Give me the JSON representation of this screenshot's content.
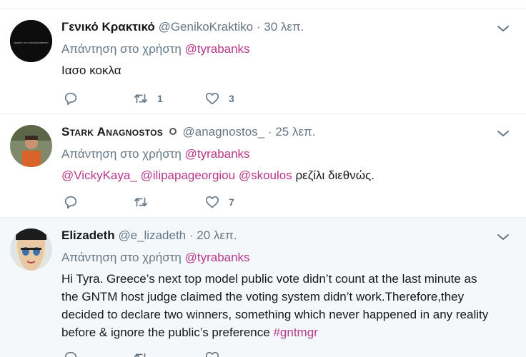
{
  "tweets": [
    {
      "fullname": "Γενικό Κρακτικό",
      "username": "@GenikoKraktiko",
      "separator": "·",
      "time": "30 λεπ.",
      "reply_prefix": "Απάντηση στο χρήστη",
      "reply_to": "@tyrabanks",
      "text": "Ιασο κοκλα",
      "retweets": "1",
      "likes": "3",
      "avatar": "dark-logo-avatar",
      "avatar_text": "Αρχεία του κατακαλυψπτού"
    },
    {
      "fullname": "Stark Anagnostos",
      "username": "@anagnostos_",
      "separator": "·",
      "time": "25 λεπ.",
      "reply_prefix": "Απάντηση στο χρήστη",
      "reply_to": "@tyrabanks",
      "mentions": [
        "@VickyKaya_",
        "@ilipapageorgiou",
        "@skoulos"
      ],
      "text": "ρεζίλι διεθνώς.",
      "retweets": "",
      "likes": "7",
      "avatar": "person-orange-avatar"
    },
    {
      "fullname": "Elizadeth",
      "username": "@e_lizadeth",
      "separator": "·",
      "time": "20 λεπ.",
      "reply_prefix": "Απάντηση στο χρήστη",
      "reply_to": "@tyrabanks",
      "text_lines": [
        "Hi Tyra. Greece’s next top model public vote didn’t count at the last minute as",
        "the GNTM host judge claimed the voting system didn’t work.Therefore,they",
        "decided to declare two winners, something which never happened in any reality",
        "before & ignore the public’s preference"
      ],
      "hashtag": "#gntmgr",
      "retweets": "",
      "likes": "",
      "avatar": "cartoon-girl-avatar"
    }
  ],
  "colors": {
    "link": "#b5378a",
    "secondary_text": "#657786",
    "highlight_bg": "#f5f8fa",
    "divider": "#e6ecf0"
  },
  "icons": [
    "reply-icon",
    "retweet-icon",
    "heart-icon",
    "chevron-down-icon",
    "verified-icon"
  ]
}
